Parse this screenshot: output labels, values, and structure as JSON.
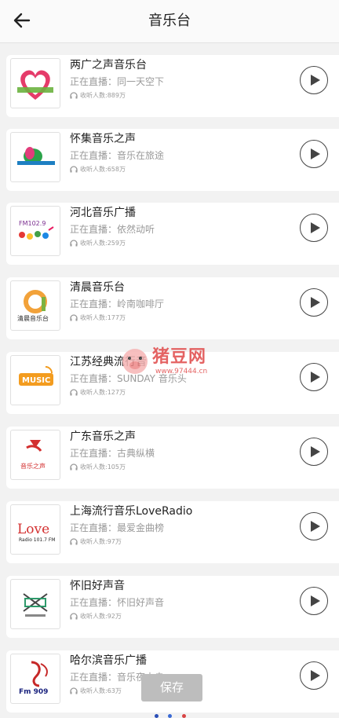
{
  "header": {
    "title": "音乐台"
  },
  "stations": [
    {
      "name": "两广之声音乐台",
      "live": "正在直播：同一天空下",
      "listeners": "收听人数:889万",
      "logo": "heart-logo"
    },
    {
      "name": "怀集音乐之声",
      "live": "正在直播：音乐在旅途",
      "listeners": "收听人数:658万",
      "logo": "huaiji-logo"
    },
    {
      "name": "河北音乐广播",
      "live": "正在直播：依然动听",
      "listeners": "收听人数:259万",
      "logo": "hebei-logo"
    },
    {
      "name": "清晨音乐台",
      "live": "正在直播：岭南咖啡厅",
      "listeners": "收听人数:177万",
      "logo": "qingchen-logo"
    },
    {
      "name": "江苏经典流行音",
      "live": "正在直播：SUNDAY 音乐头",
      "listeners": "收听人数:127万",
      "logo": "music-logo"
    },
    {
      "name": "广东音乐之声",
      "live": "正在直播：古典纵横",
      "listeners": "收听人数:105万",
      "logo": "guangdong-logo"
    },
    {
      "name": "上海流行音乐LoveRadio",
      "live": "正在直播：最爱金曲榜",
      "listeners": "收听人数:97万",
      "logo": "love-logo"
    },
    {
      "name": "怀旧好声音",
      "live": "正在直播：怀旧好声音",
      "listeners": "收听人数:92万",
      "logo": "huaijiu-logo"
    },
    {
      "name": "哈尔滨音乐广播",
      "live": "正在直播：音乐夜未央",
      "listeners": "收听人数:63万",
      "logo": "harbin-logo"
    }
  ],
  "logo_text": {
    "hebei": "FM102.9",
    "qingchen": "清晨音乐台",
    "music": "MUSIC",
    "guangdong": "音乐之声",
    "love": "Love",
    "love_sub": "Radio 101.7 FM",
    "harbin": "Fm 909",
    "huaiji": "怀集音乐之声"
  },
  "watermark": {
    "text": "猪豆网",
    "url": "www.97444.cn"
  },
  "save_label": "保存",
  "colors": {
    "accent_red": "#e04848",
    "save_bg": "#bdbdbd",
    "dot_colors": [
      "#2b4fb8",
      "#3a6ad4",
      "#d84545"
    ]
  }
}
